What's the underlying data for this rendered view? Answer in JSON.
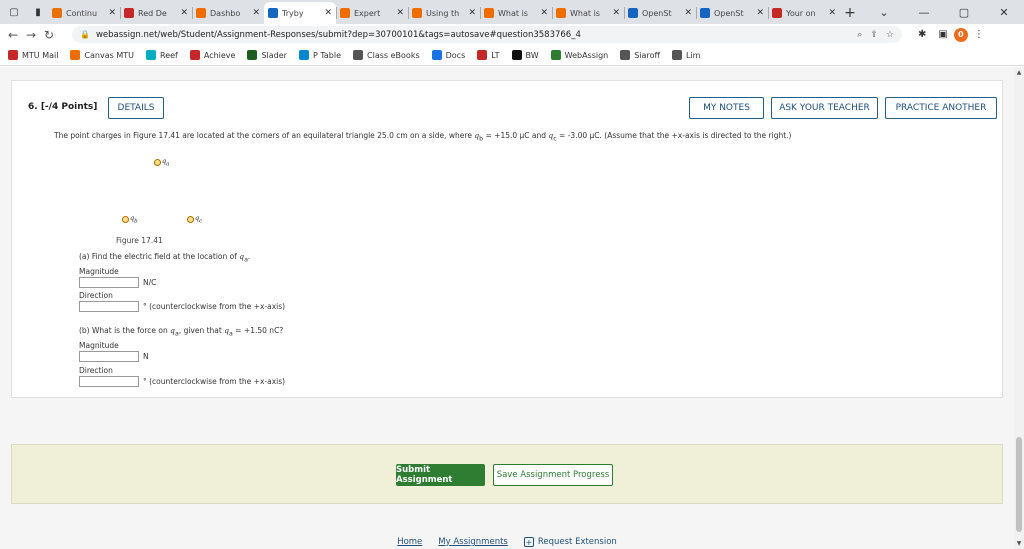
{
  "browser": {
    "tabs": [
      {
        "title": "Continu",
        "icon_color": "#e8710a",
        "icon": "person-icon"
      },
      {
        "title": "Red De",
        "icon_color": "#c62828",
        "icon": "vg-icon"
      },
      {
        "title": "Dashbo",
        "icon_color": "#ef6c00",
        "icon": "canvas-icon"
      },
      {
        "title": "Tryby",
        "icon_color": "#1565c0",
        "icon": "w-icon"
      },
      {
        "title": "Expert",
        "icon_color": "#ef6c00",
        "icon": "chegg-icon"
      },
      {
        "title": "Using th",
        "icon_color": "#ef6c00",
        "icon": "chegg-icon"
      },
      {
        "title": "What is",
        "icon_color": "#ef6c00",
        "icon": "chegg-icon"
      },
      {
        "title": "What is",
        "icon_color": "#ef6c00",
        "icon": "chegg-icon"
      },
      {
        "title": "OpenSt",
        "icon_color": "#1565c0",
        "icon": "openstax-icon"
      },
      {
        "title": "OpenSt",
        "icon_color": "#1565c0",
        "icon": "openstax-icon"
      },
      {
        "title": "Your on",
        "icon_color": "#c62828",
        "icon": "gmail-icon"
      }
    ],
    "active_tab_index": 3,
    "url": "webassign.net/web/Student/Assignment-Responses/submit?dep=30700101&tags=autosave#question3583766_4",
    "profile_initial": "0",
    "bookmarks": [
      {
        "label": "MTU Mail",
        "color": "#c62828",
        "icon": "gmail-icon"
      },
      {
        "label": "Canvas MTU",
        "color": "#ef6c00",
        "icon": "canvas-icon"
      },
      {
        "label": "Reef",
        "color": "#00acc1",
        "icon": "reef-icon"
      },
      {
        "label": "Achieve",
        "color": "#c62828",
        "icon": "achieve-icon"
      },
      {
        "label": "Slader",
        "color": "#1b5e20",
        "icon": "slader-icon"
      },
      {
        "label": "P Table",
        "color": "#0288d1",
        "icon": "ptable-icon"
      },
      {
        "label": "Class eBooks",
        "color": "#555555",
        "icon": "globe-icon"
      },
      {
        "label": "Docs",
        "color": "#1a73e8",
        "icon": "docs-icon"
      },
      {
        "label": "LT",
        "color": "#c62828",
        "icon": "lt-icon"
      },
      {
        "label": "BW",
        "color": "#111111",
        "icon": "bw-icon"
      },
      {
        "label": "WebAssign",
        "color": "#2e7d32",
        "icon": "webassign-icon"
      },
      {
        "label": "Siaroff",
        "color": "#555555",
        "icon": "globe-icon"
      },
      {
        "label": "Lim",
        "color": "#555555",
        "icon": "globe-icon"
      }
    ]
  },
  "question": {
    "number_label": "6.  [-/4 Points]",
    "details_label": "DETAILS",
    "my_notes_label": "MY NOTES",
    "ask_teacher_label": "ASK YOUR TEACHER",
    "practice_label": "PRACTICE ANOTHER",
    "prompt_start": "The point charges in Figure 17.41 are located at the corners of an equilateral triangle 25.0 cm on a side, where ",
    "qb_sym": "q",
    "qb_sub": "b",
    "qb_val": " = +15.0 μC and ",
    "qc_sym": "q",
    "qc_sub": "c",
    "qc_val": " = -3.00 μC. (Assume that the +x-axis is directed to the right.)",
    "charges": {
      "a": "q",
      "a_sub": "a",
      "b": "q",
      "b_sub": "b",
      "c": "q",
      "c_sub": "c"
    },
    "figure_caption": "Figure 17.41",
    "part_a_prefix": "(a) Find the electric field at the location of ",
    "part_a_sym": "q",
    "part_a_sub": "a",
    "part_a_suffix": ".",
    "part_a": {
      "magnitude_label": "Magnitude",
      "magnitude_value": "",
      "magnitude_unit": "N/C",
      "direction_label": "Direction",
      "direction_value": "",
      "direction_unit": "° (counterclockwise from the +x-axis)"
    },
    "part_b_prefix": "(b) What is the force on ",
    "part_b_sym": "q",
    "part_b_sub": "a",
    "part_b_mid": ", given that ",
    "part_b_sym2": "q",
    "part_b_sub2": "a",
    "part_b_suffix": " = +1.50 nC?",
    "part_b": {
      "magnitude_label": "Magnitude",
      "magnitude_value": "",
      "magnitude_unit": "N",
      "direction_label": "Direction",
      "direction_value": "",
      "direction_unit": "° (counterclockwise from the +x-axis)"
    }
  },
  "actions": {
    "submit_label": "Submit Assignment",
    "save_label": "Save Assignment Progress"
  },
  "footer": {
    "home": "Home",
    "my_assignments": "My Assignments",
    "extension": "Request Extension"
  }
}
